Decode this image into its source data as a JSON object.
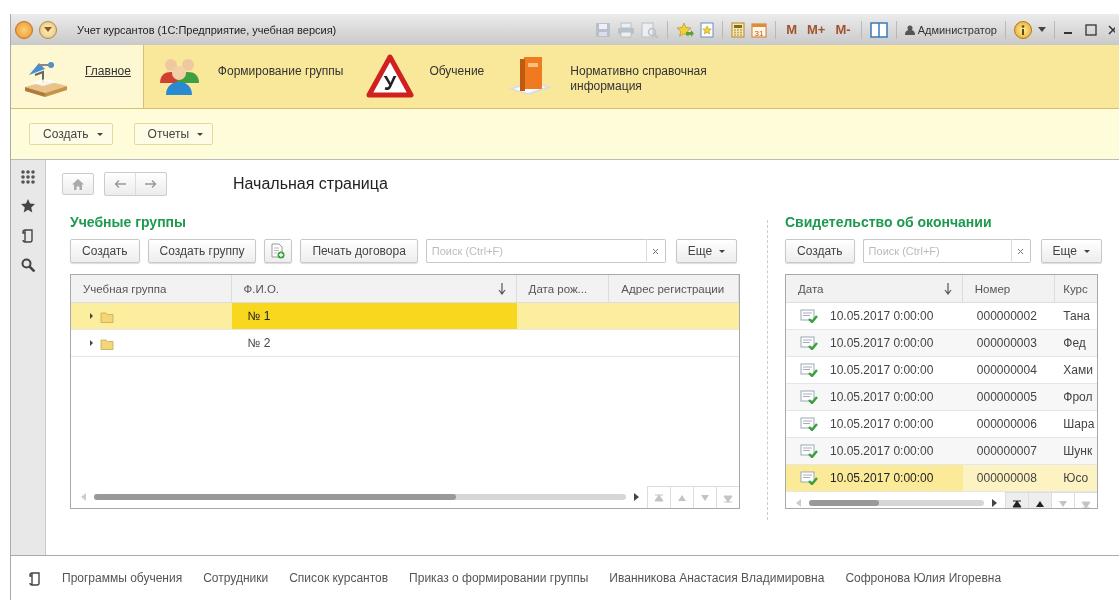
{
  "window": {
    "title": "Учет курсантов  (1С:Предприятие, учебная версия)",
    "user": "Администратор"
  },
  "tools": [
    {
      "kind": "save",
      "disabled": true
    },
    {
      "kind": "print",
      "disabled": true
    },
    {
      "kind": "preview",
      "disabled": true
    },
    {
      "kind": "fav-add",
      "disabled": false
    },
    {
      "kind": "fav",
      "disabled": false
    },
    {
      "kind": "calc",
      "disabled": false
    },
    {
      "kind": "calendar",
      "text": "31",
      "disabled": false
    },
    {
      "kind": "mem",
      "text": "M",
      "disabled": false
    },
    {
      "kind": "mem",
      "text": "M+",
      "disabled": false
    },
    {
      "kind": "mem",
      "text": "M-",
      "disabled": false
    },
    {
      "kind": "panels",
      "disabled": false
    }
  ],
  "sections": [
    {
      "label": "Главное",
      "kind": "desk",
      "selected": true
    },
    {
      "label": "Формирование группы",
      "kind": "people",
      "selected": false
    },
    {
      "label": "Обучение",
      "kind": "sign",
      "badge": "У",
      "selected": false
    },
    {
      "label": "Нормативно справочная информация",
      "kind": "book",
      "selected": false
    }
  ],
  "commands": [
    "Создать",
    "Отчеты"
  ],
  "page_title": "Начальная страница",
  "groups": {
    "title": "Учебные группы",
    "buttons": [
      {
        "kind": "text",
        "label": "Создать"
      },
      {
        "kind": "text",
        "label": "Создать группу"
      },
      {
        "kind": "add-doc"
      },
      {
        "kind": "text",
        "label": "Печать договора"
      }
    ],
    "search": {
      "placeholder": "Поиск (Ctrl+F)"
    },
    "more": "Еще",
    "columns": [
      {
        "label": "Учебная группа",
        "sorted": false
      },
      {
        "label": "Ф.И.О.",
        "sorted": true
      },
      {
        "label": "Дата рож...",
        "sorted": false
      },
      {
        "label": "Адрес регистрации",
        "sorted": false
      }
    ],
    "rows": [
      {
        "name": "№ 1",
        "selected": true,
        "expanded": false
      },
      {
        "name": "№ 2",
        "selected": false,
        "expanded": false
      }
    ],
    "pager": [
      {
        "kind": "first",
        "disabled": true
      },
      {
        "kind": "up",
        "disabled": true
      },
      {
        "kind": "down",
        "disabled": true
      },
      {
        "kind": "last",
        "disabled": true
      }
    ]
  },
  "certificates": {
    "title": "Свидетельство об окончании",
    "button": "Создать",
    "search": {
      "placeholder": "Поиск (Ctrl+F)"
    },
    "more": "Еще",
    "columns": [
      {
        "label": "Дата",
        "sorted": true
      },
      {
        "label": "Номер",
        "sorted": false
      },
      {
        "label": "Курс",
        "sorted": false
      }
    ],
    "rows": [
      {
        "date": "10.05.2017 0:00:00",
        "number": "000000002",
        "course": "Тана",
        "selected": false
      },
      {
        "date": "10.05.2017 0:00:00",
        "number": "000000003",
        "course": "Фед",
        "selected": false
      },
      {
        "date": "10.05.2017 0:00:00",
        "number": "000000004",
        "course": "Хами",
        "selected": false
      },
      {
        "date": "10.05.2017 0:00:00",
        "number": "000000005",
        "course": "Фрол",
        "selected": false
      },
      {
        "date": "10.05.2017 0:00:00",
        "number": "000000006",
        "course": "Шара",
        "selected": false
      },
      {
        "date": "10.05.2017 0:00:00",
        "number": "000000007",
        "course": "Шунк",
        "selected": false
      },
      {
        "date": "10.05.2017 0:00:00",
        "number": "000000008",
        "course": "Юсо",
        "selected": true
      }
    ],
    "pager": [
      {
        "kind": "first",
        "disabled": false
      },
      {
        "kind": "up",
        "disabled": false
      },
      {
        "kind": "down",
        "disabled": true
      },
      {
        "kind": "last",
        "disabled": true
      }
    ]
  },
  "history": [
    "Программы обучения",
    "Сотрудники",
    "Список курсантов",
    "Приказ о формировании группы",
    "Иванникова Анастасия Владимировна",
    "Софронова Юлия Игоревна"
  ]
}
